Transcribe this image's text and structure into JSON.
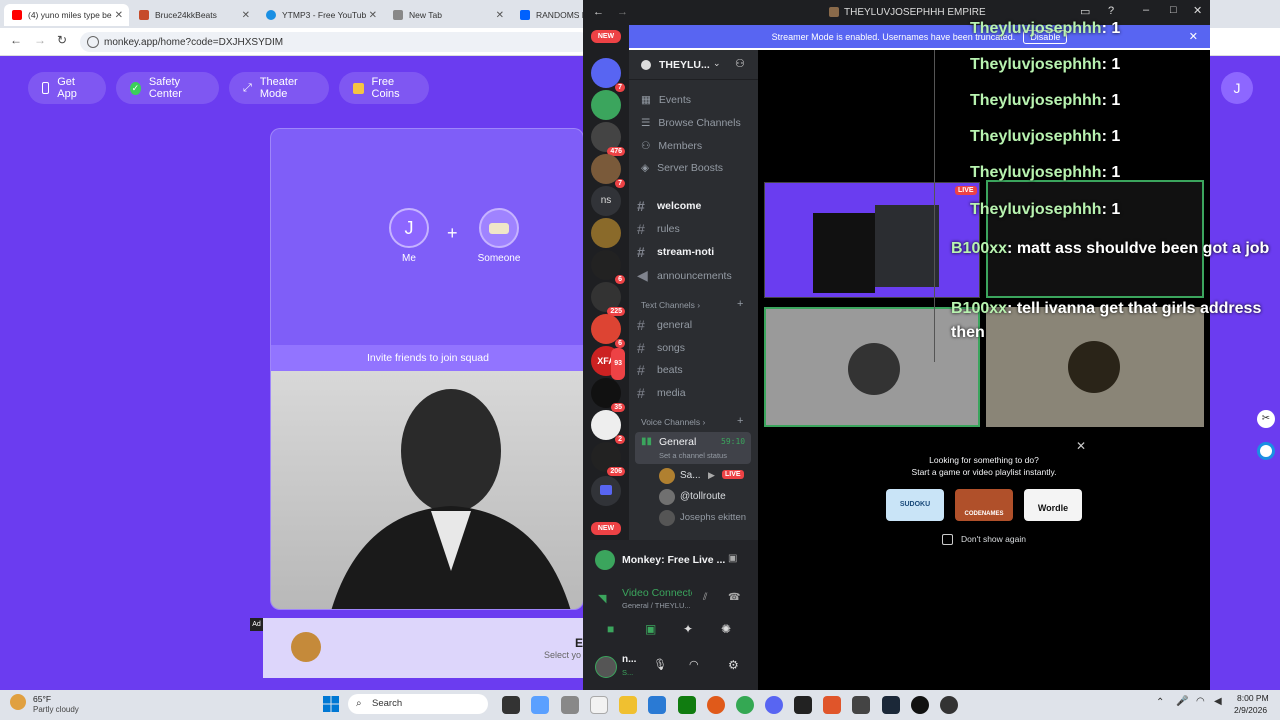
{
  "browser": {
    "tabs": [
      {
        "label": "(4) yuno miles type be",
        "color": "#ff0000"
      },
      {
        "label": "Bruce24kkBeats",
        "color": "#c64b2b"
      },
      {
        "label": "YTMP3 - Free YouTub",
        "color": "#1a8fe3"
      },
      {
        "label": "New Tab",
        "color": "#888888"
      },
      {
        "label": "RANDOMS FO",
        "color": "#0061fe"
      }
    ],
    "url": "monkey.app/home?code=DXJHXSYDIM"
  },
  "monkey": {
    "nav": [
      "Get App",
      "Safety Center",
      "Theater Mode",
      "Free Coins"
    ],
    "me_initial": "J",
    "me_label": "Me",
    "someone_label": "Someone",
    "plus": "+",
    "invite_text": "Invite friends to join squad",
    "ad_badge": "Ad",
    "ad_title": "E",
    "ad_sub": "Select yo",
    "profile_initial": "J"
  },
  "discord": {
    "window_title": "THEYLUVJOSEPHHH EMPIRE",
    "banner_text": "Streamer Mode is enabled. Usernames have been truncated.",
    "banner_button": "Disable",
    "server_name": "THEYLU...",
    "guild_badges": [
      "NEW",
      "7",
      "476",
      "7",
      "ns",
      "6",
      "225",
      "6",
      "93",
      "35",
      "2",
      "206",
      "NEW"
    ],
    "top_items": [
      "Events",
      "Browse Channels",
      "Members",
      "Server Boosts"
    ],
    "channels_top": [
      "welcome",
      "rules",
      "stream-noti",
      "announcements"
    ],
    "text_header": "Text Channels",
    "text_channels": [
      "general",
      "songs",
      "beats",
      "media"
    ],
    "voice_header": "Voice Channels",
    "voice_channel": "General",
    "voice_timer": "59:10",
    "voice_status": "Set a channel status",
    "voice_users": [
      "Sa...",
      "@tollroute",
      "Josephs ekitten"
    ],
    "live_badge": "LIVE",
    "activity_title": "Monkey: Free Live ...",
    "connection_status": "Video Connected",
    "connection_sub": "General / THEYLU...",
    "user_short": "n...",
    "user_sub": "S...",
    "activity_prompt1": "Looking for something to do?",
    "activity_prompt2": "Start a game or video playlist instantly.",
    "activity_games": [
      "SUDOKU",
      "CODENAMES",
      "Wordle"
    ],
    "dont_show": "Don't show again",
    "stage_live": "LIVE"
  },
  "chat": [
    {
      "name": "Theyluvjosephhh",
      "msg": "1"
    },
    {
      "name": "Theyluvjosephhh",
      "msg": "1"
    },
    {
      "name": "Theyluvjosephhh",
      "msg": "1"
    },
    {
      "name": "Theyluvjosephhh",
      "msg": "1"
    },
    {
      "name": "Theyluvjosephhh",
      "msg": "1"
    },
    {
      "name": "Theyluvjosephhh",
      "msg": "1"
    },
    {
      "name": "B100xx",
      "msg": "matt ass shouldve been got a job"
    },
    {
      "name": "B100xx",
      "msg": "tell ivanna get that girls address then"
    }
  ],
  "taskbar": {
    "weather_temp": "65°F",
    "weather_desc": "Partly cloudy",
    "search": "Search",
    "time": "8:00 PM",
    "date": "2/9/2026"
  },
  "colors": {
    "monkey_bg": "#6b3cf0",
    "discord_blurple": "#5865f2",
    "chat_name": "#b8f3b0"
  }
}
